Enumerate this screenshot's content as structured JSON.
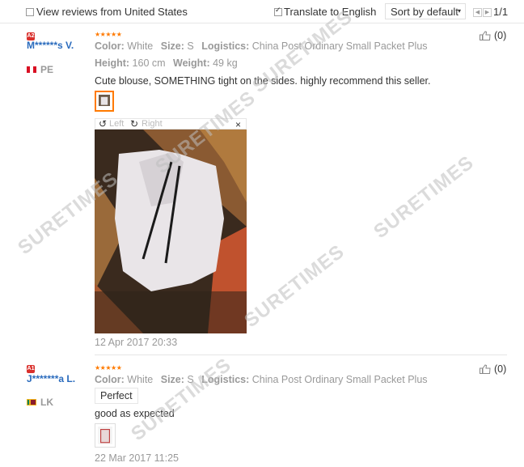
{
  "toolbar": {
    "view_from_label": "View reviews from United States",
    "view_from_checked": false,
    "translate_label": "Translate to English",
    "translate_checked": true,
    "sort_label": "Sort by default",
    "page_indicator": "1/1"
  },
  "labels": {
    "color": "Color:",
    "size": "Size:",
    "logistics": "Logistics:",
    "height": "Height:",
    "weight": "Weight:"
  },
  "reviews": [
    {
      "level_badge": "A2",
      "username": "M******s V.",
      "country": "PE",
      "stars": "★★★★★",
      "color": "White",
      "size": "S",
      "logistics": "China Post Ordinary Small Packet Plus",
      "height": "160 cm",
      "weight": "49 kg",
      "text": "Cute blouse, SOMETHING tight on the sides. highly recommend this seller.",
      "viewer": {
        "left_label": "Left",
        "right_label": "Right",
        "close_label": "×"
      },
      "date": "12 Apr 2017 20:33",
      "helpful_count": "(0)"
    },
    {
      "level_badge": "A1",
      "username": "J*******a L.",
      "country": "LK",
      "stars": "★★★★★",
      "color": "White",
      "size": "S",
      "logistics": "China Post Ordinary Small Packet Plus",
      "tag": "Perfect",
      "text": "good as expected",
      "date": "22 Mar 2017 11:25",
      "helpful_count": "(0)"
    }
  ],
  "watermark": "SURETIMES",
  "colors": {
    "accent": "#ff7a00",
    "username": "#2a6bbd",
    "badge": "#d9302c",
    "muted": "#999999"
  }
}
